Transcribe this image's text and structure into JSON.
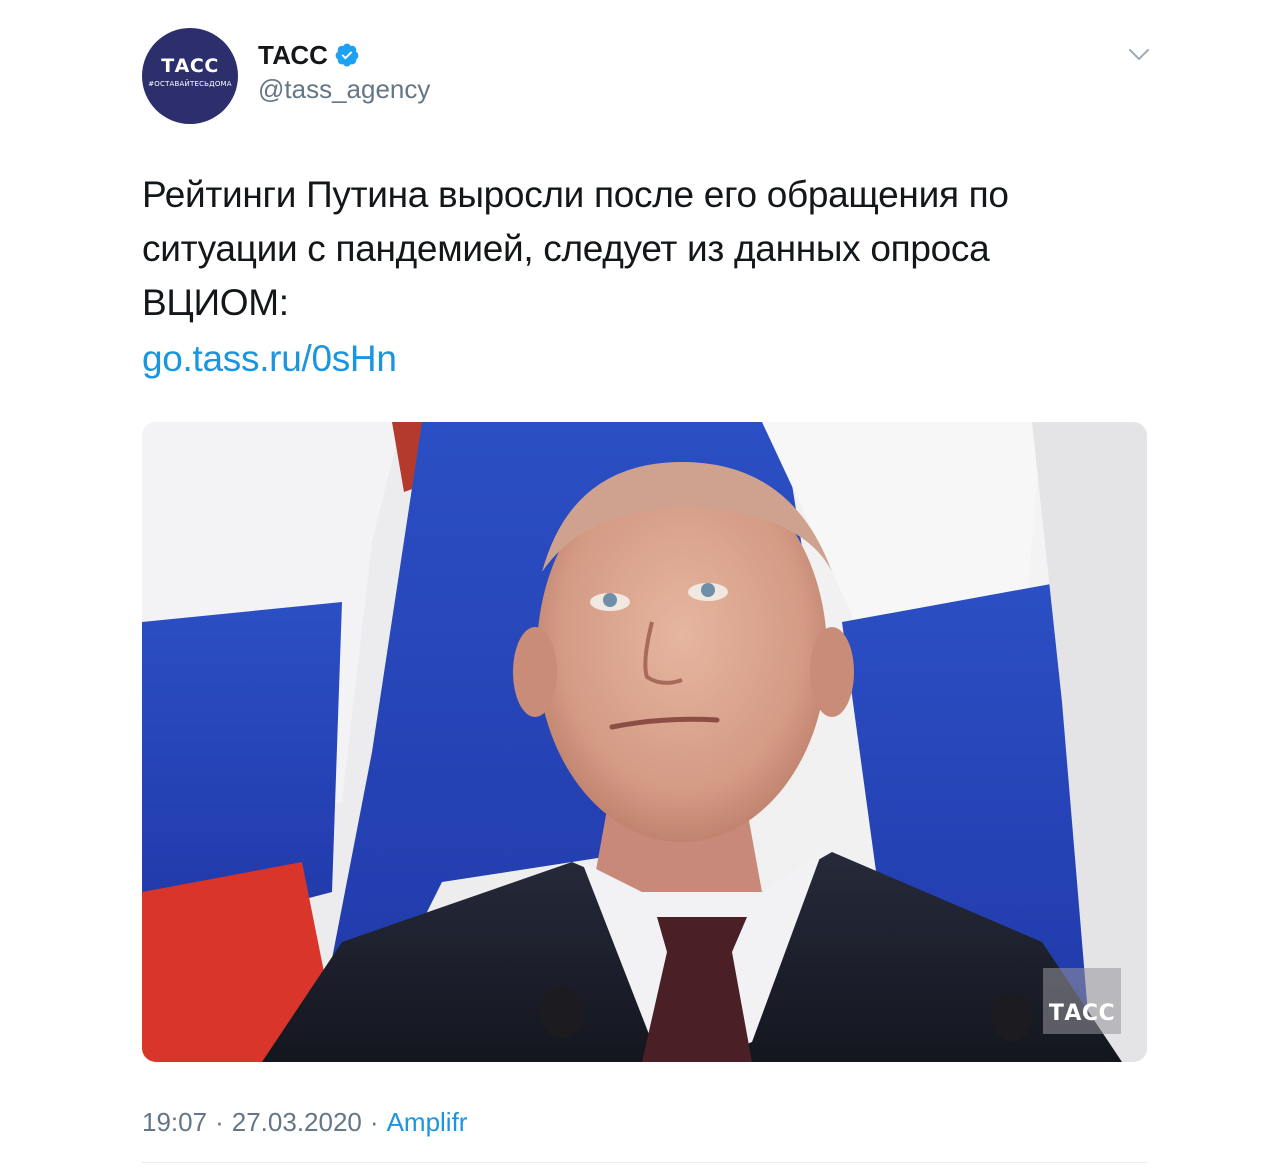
{
  "tweet": {
    "avatar": {
      "logo_text": "ТАСС",
      "tagline": "#ОСТАВАЙТЕСЬДОМА",
      "background": "#2c2f6b"
    },
    "author_name": "ТАСС",
    "verified": true,
    "handle": "@tass_agency",
    "text_lines": [
      "Рейтинги Путина выросли после его обращения по",
      "ситуации с пандемией, следует из данных опроса",
      "ВЦИОМ:"
    ],
    "link": "go.tass.ru/0sHn",
    "media": {
      "description_icon": "photo",
      "watermark": "ТАСС"
    },
    "time": "19:07",
    "date": "27.03.2020",
    "separator": "·",
    "source": "Amplifr"
  },
  "colors": {
    "text": "#14171a",
    "secondary": "#657786",
    "link": "#1b95e0",
    "verified": "#1da1f2"
  },
  "icons": {
    "verified": "verified-badge-icon",
    "caret": "chevron-down-icon"
  }
}
